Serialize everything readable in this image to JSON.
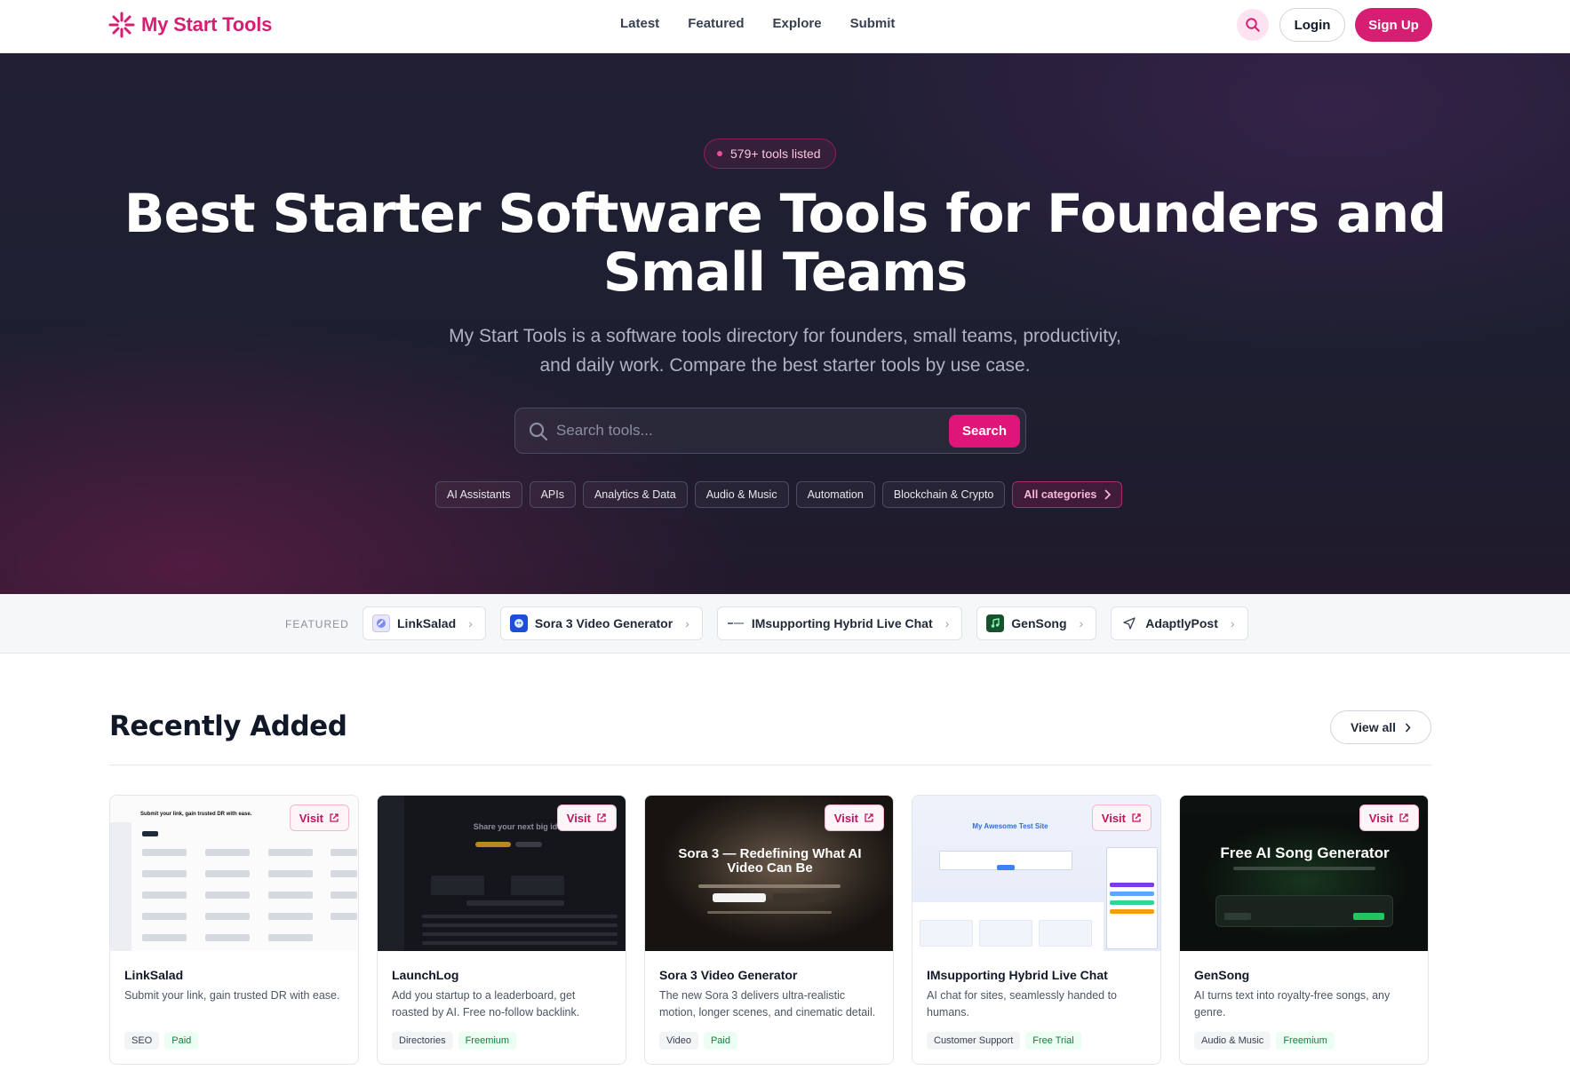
{
  "header": {
    "logo_text": "My Start Tools",
    "nav": [
      "Latest",
      "Featured",
      "Explore",
      "Submit"
    ],
    "login_label": "Login",
    "signup_label": "Sign Up",
    "brand_color": "#d61f73"
  },
  "hero": {
    "badge": "579+ tools listed",
    "title": "Best Starter Software Tools for Founders and Small Teams",
    "subtitle": "My Start Tools is a software tools directory for founders, small teams, productivity, and daily work. Compare the best starter tools by use case.",
    "search_placeholder": "Search tools...",
    "search_button": "Search",
    "categories": [
      "AI Assistants",
      "APIs",
      "Analytics & Data",
      "Audio & Music",
      "Automation",
      "Blockchain & Crypto"
    ],
    "all_categories": "All categories"
  },
  "featured": {
    "label": "FEATURED",
    "items": [
      {
        "name": "LinkSalad",
        "icon": "linksalad-icon"
      },
      {
        "name": "Sora 3 Video Generator",
        "icon": "sora-icon"
      },
      {
        "name": "IMsupporting Hybrid Live Chat",
        "icon": "imsupporting-icon"
      },
      {
        "name": "GenSong",
        "icon": "music-note-icon"
      },
      {
        "name": "AdaptlyPost",
        "icon": "paper-plane-icon"
      }
    ]
  },
  "recent": {
    "title": "Recently Added",
    "view_all": "View all",
    "visit_label": "Visit",
    "cards": [
      {
        "name": "LinkSalad",
        "desc": "Submit your link, gain trusted DR with ease.",
        "tags": [
          "SEO",
          "Paid"
        ],
        "thumb_text": "Submit your link, gain trusted DR with ease."
      },
      {
        "name": "LaunchLog",
        "desc": "Add you startup to a leaderboard, get roasted by AI. Free no-follow backlink.",
        "tags": [
          "Directories",
          "Freemium"
        ],
        "thumb_text": "Share your next big idea"
      },
      {
        "name": "Sora 3 Video Generator",
        "desc": "The new Sora 3 delivers ultra-realistic motion, longer scenes, and cinematic detail.",
        "tags": [
          "Video",
          "Paid"
        ],
        "thumb_text": "Sora 3 — Redefining What AI Video Can Be"
      },
      {
        "name": "IMsupporting Hybrid Live Chat",
        "desc": "AI chat for sites, seamlessly handed to humans.",
        "tags": [
          "Customer Support",
          "Free Trial"
        ],
        "thumb_text": "My Awesome Test Site"
      },
      {
        "name": "GenSong",
        "desc": "AI turns text into royalty-free songs, any genre.",
        "tags": [
          "Audio & Music",
          "Freemium"
        ],
        "thumb_text": "Free AI Song Generator"
      }
    ]
  }
}
